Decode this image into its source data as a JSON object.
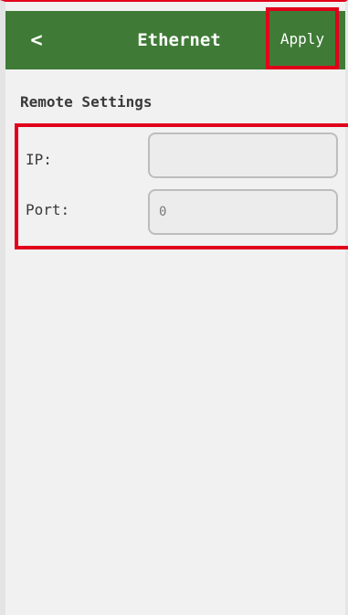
{
  "header": {
    "back_label": "<",
    "title": "Ethernet",
    "apply_label": "Apply"
  },
  "section": {
    "title": "Remote Settings"
  },
  "form": {
    "ip_label": "IP:",
    "ip_value": "",
    "port_label": "Port:",
    "port_value": "0"
  },
  "colors": {
    "header_bg": "#3f7a36",
    "highlight": "#e1001a"
  }
}
